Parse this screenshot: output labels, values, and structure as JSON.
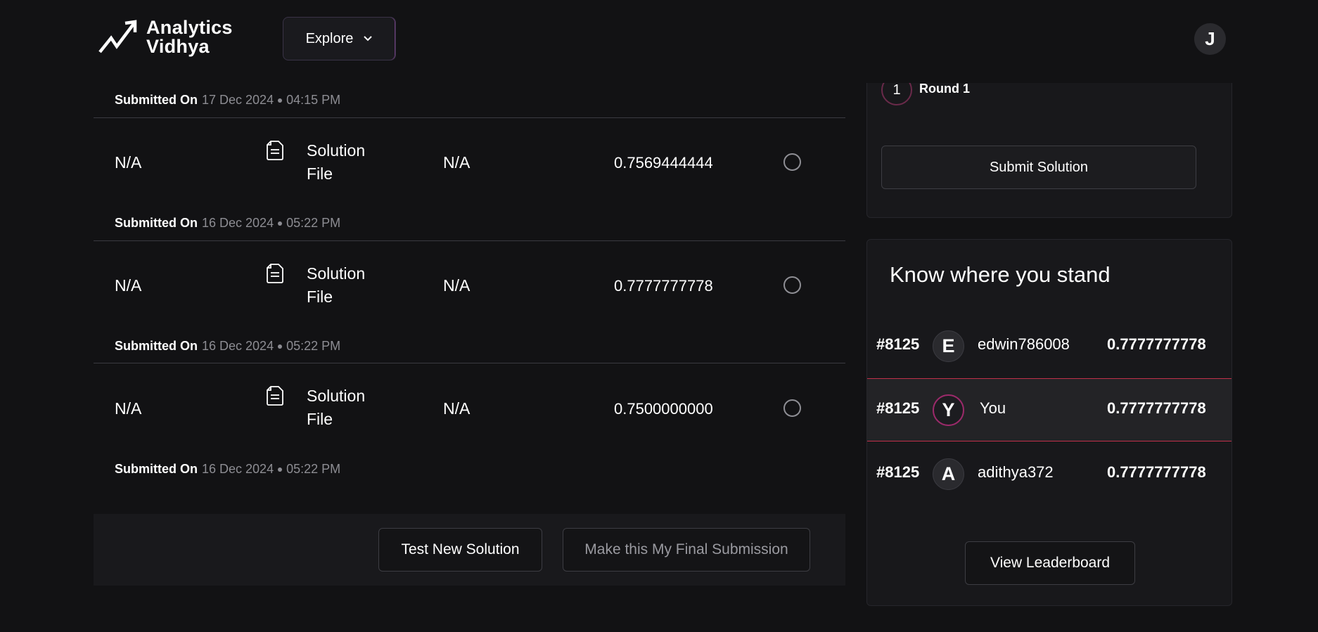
{
  "header": {
    "logo_line1": "Analytics",
    "logo_line2": "Vidhya",
    "explore_label": "Explore",
    "user_initial": "J"
  },
  "submissions": {
    "submitted_label": "Submitted On",
    "first_meta": {
      "date": "17 Dec 2024",
      "time": "04:15 PM"
    },
    "rows": [
      {
        "col1": "N/A",
        "file_label": "Solution File",
        "col3": "N/A",
        "score": "0.7569444444",
        "meta": {
          "date": "16 Dec 2024",
          "time": "05:22 PM"
        }
      },
      {
        "col1": "N/A",
        "file_label": "Solution File",
        "col3": "N/A",
        "score": "0.7777777778",
        "meta": {
          "date": "16 Dec 2024",
          "time": "05:22 PM"
        }
      },
      {
        "col1": "N/A",
        "file_label": "Solution File",
        "col3": "N/A",
        "score": "0.7500000000",
        "meta": {
          "date": "16 Dec 2024",
          "time": "05:22 PM"
        }
      }
    ]
  },
  "actions": {
    "test_new_label": "Test New Solution",
    "final_submission_label": "Make this My Final Submission"
  },
  "round": {
    "number": "1",
    "label": "Round 1",
    "submit_label": "Submit Solution"
  },
  "leaderboard": {
    "title": "Know where you stand",
    "rows": [
      {
        "rank": "#8125",
        "initial": "E",
        "name": "edwin786008",
        "score": "0.7777777778"
      },
      {
        "rank": "#8125",
        "initial": "Y",
        "name": "You",
        "score": "0.7777777778"
      },
      {
        "rank": "#8125",
        "initial": "A",
        "name": "adithya372",
        "score": "0.7777777778"
      }
    ],
    "view_label": "View Leaderboard"
  }
}
